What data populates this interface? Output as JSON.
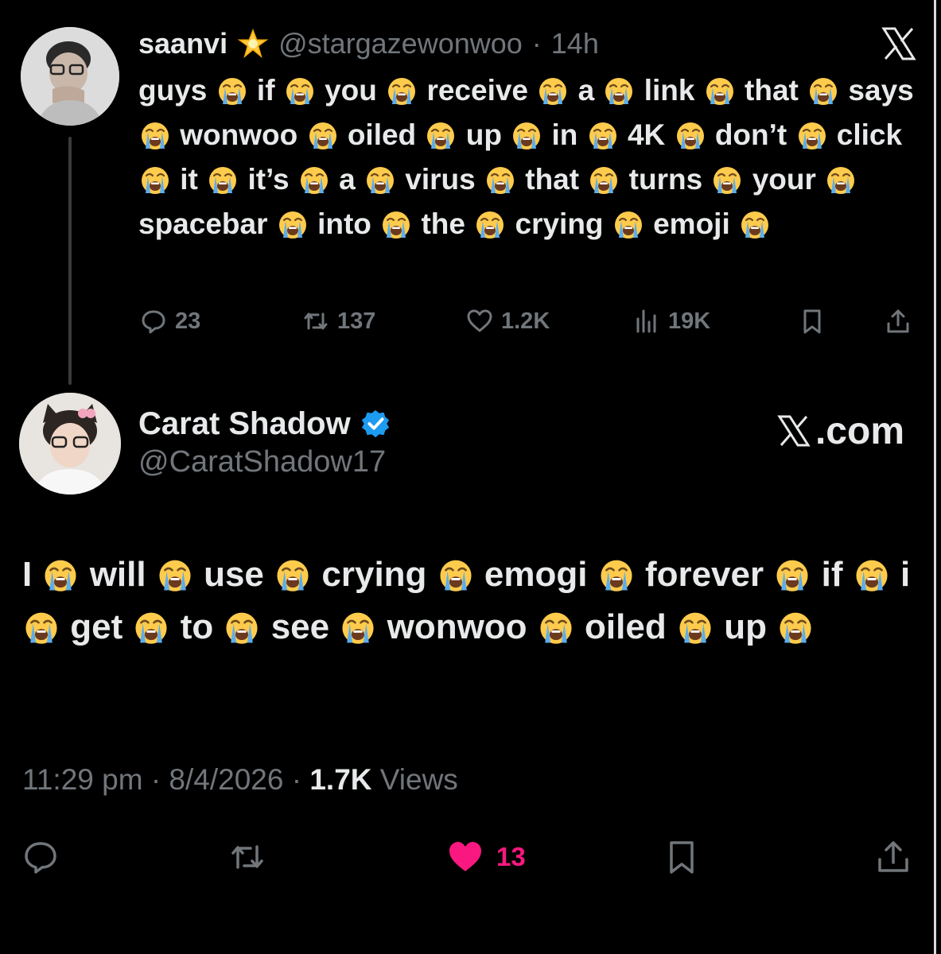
{
  "tweet1": {
    "author_name": "saanvi",
    "name_emoji": "glowing-star",
    "handle": "@stargazewonwoo",
    "separator": "·",
    "time": "14h",
    "words": [
      "guys",
      "if",
      "you",
      "receive",
      "a",
      "link",
      "that",
      "says",
      "wonwoo",
      "oiled",
      "up",
      "in",
      "4K",
      "don’t",
      "click",
      "it",
      "it’s",
      "a",
      "virus",
      "that",
      "turns",
      "your",
      "spacebar",
      "into",
      "the",
      "crying",
      "emoji"
    ],
    "emoji_after_each": "loudly-crying-face",
    "replies": "23",
    "reposts": "137",
    "likes": "1.2K",
    "views": "19K"
  },
  "tweet2": {
    "author_name": "Carat Shadow",
    "verified_badge": "blue-check",
    "handle": "@CaratShadow17",
    "source_label": ".com",
    "words": [
      "I",
      "will",
      "use",
      "crying",
      "emogi",
      "forever",
      "if",
      "i",
      "get",
      "to",
      "see",
      "wonwoo",
      "oiled",
      "up"
    ],
    "emoji_after_each": "loudly-crying-face",
    "timestamp": "11:29 pm",
    "date": "8/4/2026",
    "views_count": "1.7K",
    "views_label": "Views",
    "likes": "13",
    "like_color": "#f91880"
  },
  "theme": {
    "background": "#000000",
    "text": "#e7e9ea",
    "muted": "#71767b",
    "verified": "#1d9bf0"
  }
}
